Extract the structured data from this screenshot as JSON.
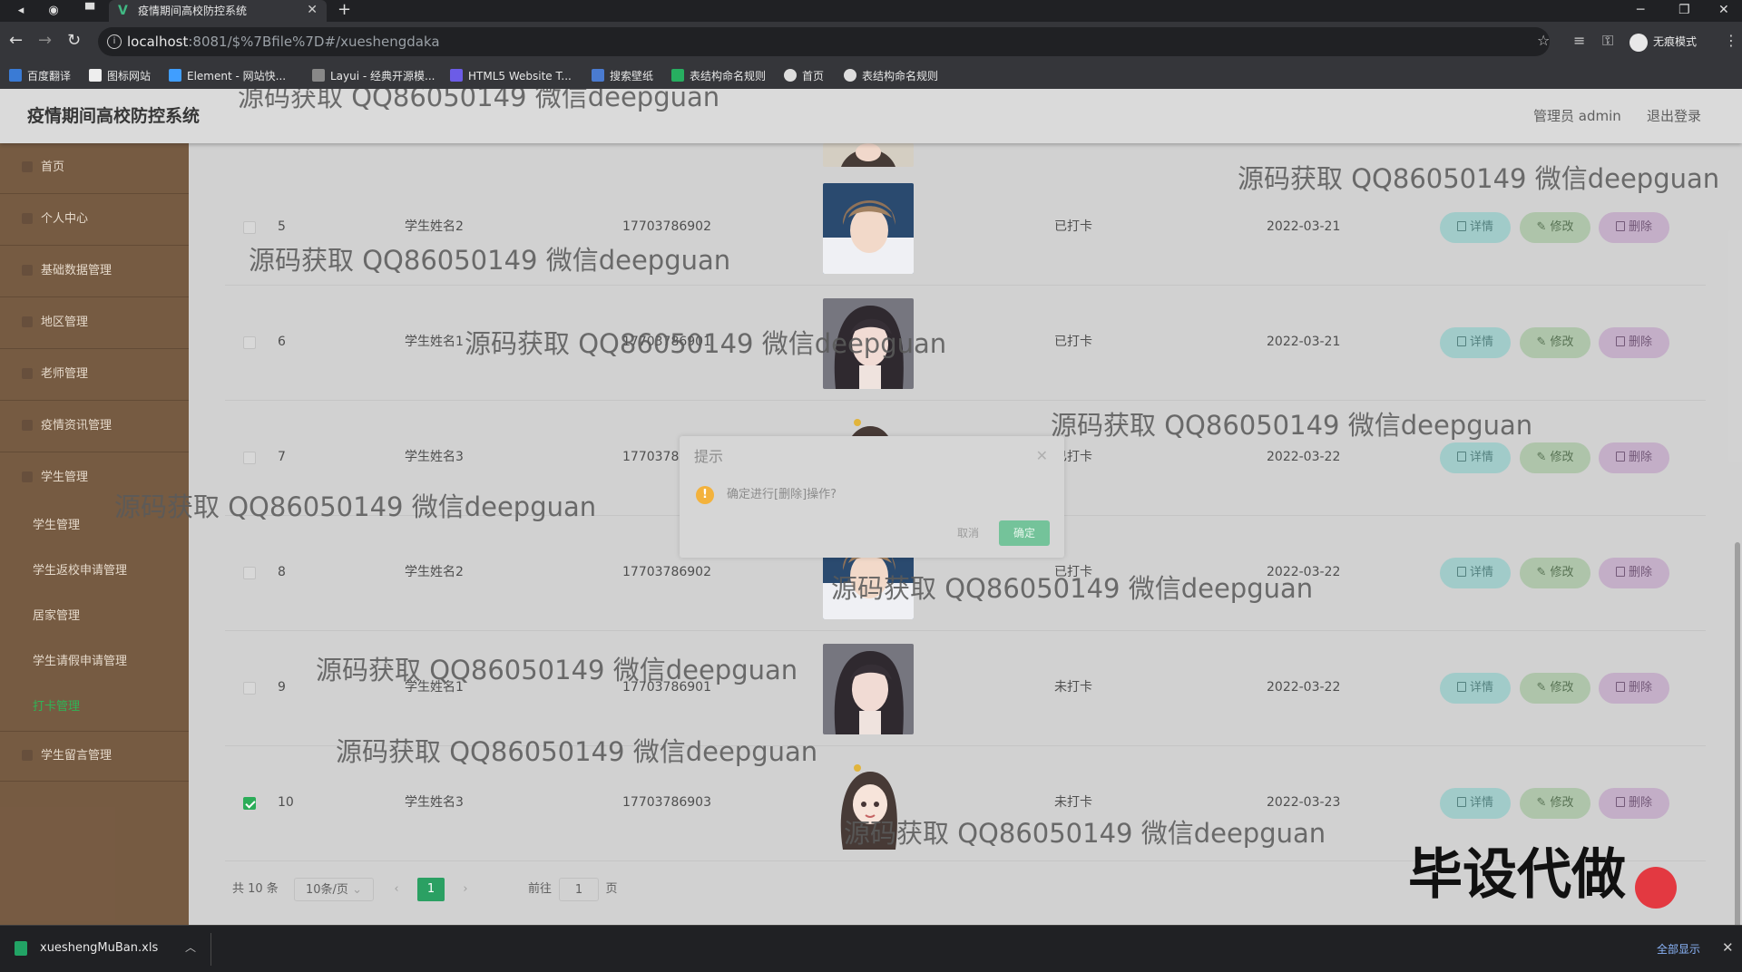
{
  "browser": {
    "tab_title": "疫情期间高校防控系统",
    "url_host": "localhost",
    "url_rest": ":8081/$%7Bfile%7D#/xueshengdaka",
    "incognito_label": "无痕模式",
    "bookmarks": [
      "百度翻译",
      "图标网站",
      "Element - 网站快...",
      "Layui - 经典开源模...",
      "HTML5 Website T...",
      "搜索壁纸",
      "表结构命名规则",
      "首页",
      "表结构命名规则"
    ]
  },
  "header": {
    "title": "疫情期间高校防控系统",
    "admin": "管理员 admin",
    "logout": "退出登录"
  },
  "sidebar": {
    "items": [
      "首页",
      "个人中心",
      "基础数据管理",
      "地区管理",
      "老师管理",
      "疫情资讯管理",
      "学生管理",
      "学生留言管理"
    ],
    "sub_items": [
      "学生管理",
      "学生返校申请管理",
      "居家管理",
      "学生请假申请管理",
      "打卡管理"
    ],
    "active": "打卡管理"
  },
  "table": {
    "rows": [
      {
        "index": "5",
        "name": "学生姓名2",
        "phone": "17703786902",
        "status": "已打卡",
        "date": "2022-03-21",
        "checked": false,
        "avatar": "male"
      },
      {
        "index": "6",
        "name": "学生姓名1",
        "phone": "17703786901",
        "status": "已打卡",
        "date": "2022-03-21",
        "checked": false,
        "avatar": "female-dark"
      },
      {
        "index": "7",
        "name": "学生姓名3",
        "phone": "17703786903",
        "status": "已打卡",
        "date": "2022-03-22",
        "checked": false,
        "avatar": "cartoon"
      },
      {
        "index": "8",
        "name": "学生姓名2",
        "phone": "17703786902",
        "status": "已打卡",
        "date": "2022-03-22",
        "checked": false,
        "avatar": "male"
      },
      {
        "index": "9",
        "name": "学生姓名1",
        "phone": "17703786901",
        "status": "未打卡",
        "date": "2022-03-22",
        "checked": false,
        "avatar": "female-dark"
      },
      {
        "index": "10",
        "name": "学生姓名3",
        "phone": "17703786903",
        "status": "未打卡",
        "date": "2022-03-23",
        "checked": true,
        "avatar": "cartoon"
      }
    ],
    "btn_detail": "详情",
    "btn_edit": "修改",
    "btn_delete": "删除"
  },
  "pagination": {
    "total": "共 10 条",
    "page_size": "10条/页",
    "current": "1",
    "goto_prefix": "前往",
    "goto_value": "1",
    "goto_suffix": "页"
  },
  "dialog": {
    "title": "提示",
    "message": "确定进行[删除]操作?",
    "cancel": "取消",
    "confirm": "确定"
  },
  "watermarks": {
    "text": "源码获取 QQ86050149 微信deepguan",
    "corner": "毕设代做"
  },
  "download": {
    "file": "xueshengMuBan.xls",
    "show_all": "全部显示"
  },
  "colors": {
    "sidebar": "#6e5137",
    "accent_green": "#22b14c",
    "confirm_button": "#74c39a"
  }
}
